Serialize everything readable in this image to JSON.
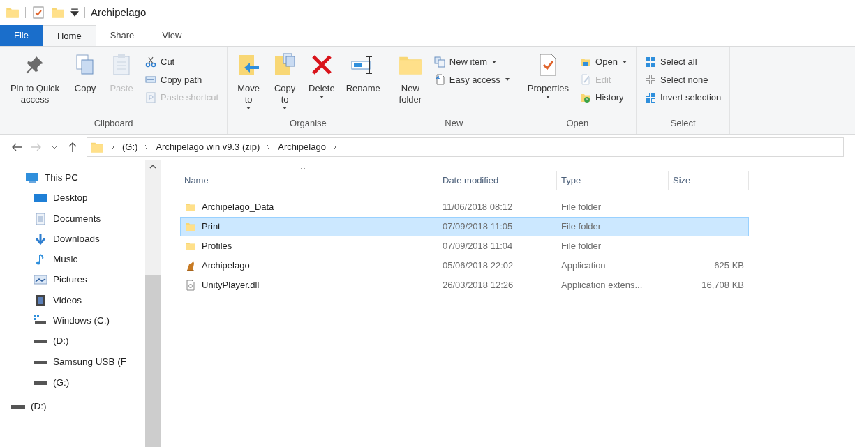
{
  "window": {
    "title": "Archipelago"
  },
  "tabs": [
    {
      "label": "File",
      "kind": "file",
      "selected": false
    },
    {
      "label": "Home",
      "kind": "tab",
      "selected": true
    },
    {
      "label": "Share",
      "kind": "tab",
      "selected": false
    },
    {
      "label": "View",
      "kind": "tab",
      "selected": false
    }
  ],
  "ribbon": {
    "groups": [
      {
        "label": "Clipboard",
        "columns": [
          {
            "kind": "large",
            "label": "Pin to Quick access",
            "disabled": false,
            "dropdown": false
          },
          {
            "kind": "large",
            "label": "Copy",
            "disabled": false,
            "dropdown": false
          },
          {
            "kind": "large",
            "label": "Paste",
            "disabled": true,
            "dropdown": false
          },
          {
            "kind": "stack",
            "items": [
              {
                "label": "Cut",
                "disabled": false,
                "dropdown": false
              },
              {
                "label": "Copy path",
                "disabled": false,
                "dropdown": false
              },
              {
                "label": "Paste shortcut",
                "disabled": true,
                "dropdown": false
              }
            ]
          }
        ]
      },
      {
        "label": "Organise",
        "columns": [
          {
            "kind": "large",
            "label": "Move to",
            "disabled": false,
            "dropdown": true
          },
          {
            "kind": "large",
            "label": "Copy to",
            "disabled": false,
            "dropdown": true
          },
          {
            "kind": "large",
            "label": "Delete",
            "disabled": false,
            "dropdown": true
          },
          {
            "kind": "large",
            "label": "Rename",
            "disabled": false,
            "dropdown": false
          }
        ]
      },
      {
        "label": "New",
        "columns": [
          {
            "kind": "large",
            "label": "New folder",
            "disabled": false,
            "dropdown": false
          },
          {
            "kind": "stack",
            "items": [
              {
                "label": "New item",
                "disabled": false,
                "dropdown": true
              },
              {
                "label": "Easy access",
                "disabled": false,
                "dropdown": true
              }
            ]
          }
        ]
      },
      {
        "label": "Open",
        "columns": [
          {
            "kind": "large",
            "label": "Properties",
            "disabled": false,
            "dropdown": true
          },
          {
            "kind": "stack",
            "items": [
              {
                "label": "Open",
                "disabled": false,
                "dropdown": true
              },
              {
                "label": "Edit",
                "disabled": true,
                "dropdown": false
              },
              {
                "label": "History",
                "disabled": false,
                "dropdown": false
              }
            ]
          }
        ]
      },
      {
        "label": "Select",
        "columns": [
          {
            "kind": "stack",
            "items": [
              {
                "label": "Select all",
                "disabled": false,
                "dropdown": false
              },
              {
                "label": "Select none",
                "disabled": false,
                "dropdown": false
              },
              {
                "label": "Invert selection",
                "disabled": false,
                "dropdown": false
              }
            ]
          }
        ]
      }
    ]
  },
  "address": {
    "segments": [
      "(G:)",
      "Archipelago win v9.3 (zip)",
      "Archipelago"
    ]
  },
  "navigation": [
    {
      "label": "This PC",
      "children": [
        {
          "label": "Desktop"
        },
        {
          "label": "Documents"
        },
        {
          "label": "Downloads"
        },
        {
          "label": "Music"
        },
        {
          "label": "Pictures"
        },
        {
          "label": "Videos"
        },
        {
          "label": "Windows (C:)"
        },
        {
          "label": "(D:)"
        },
        {
          "label": "Samsung USB (F"
        },
        {
          "label": "(G:)"
        }
      ]
    },
    {
      "label": "(D:)"
    }
  ],
  "table": {
    "columns": [
      "Name",
      "Date modified",
      "Type",
      "Size"
    ],
    "rows": [
      {
        "kind": "folder",
        "name": "Archipelago_Data",
        "date": "11/06/2018 08:12",
        "type": "File folder",
        "size": null,
        "selected": false
      },
      {
        "kind": "folder",
        "name": "Print",
        "date": "07/09/2018 11:05",
        "type": "File folder",
        "size": null,
        "selected": true
      },
      {
        "kind": "folder",
        "name": "Profiles",
        "date": "07/09/2018 11:04",
        "type": "File folder",
        "size": null,
        "selected": false
      },
      {
        "kind": "application",
        "name": "Archipelago",
        "date": "05/06/2018 22:02",
        "type": "Application",
        "size": "625 KB",
        "selected": false
      },
      {
        "kind": "library",
        "name": "UnityPlayer.dll",
        "date": "26/03/2018 12:26",
        "type": "Application extens...",
        "size": "16,708 KB",
        "selected": false
      }
    ]
  }
}
